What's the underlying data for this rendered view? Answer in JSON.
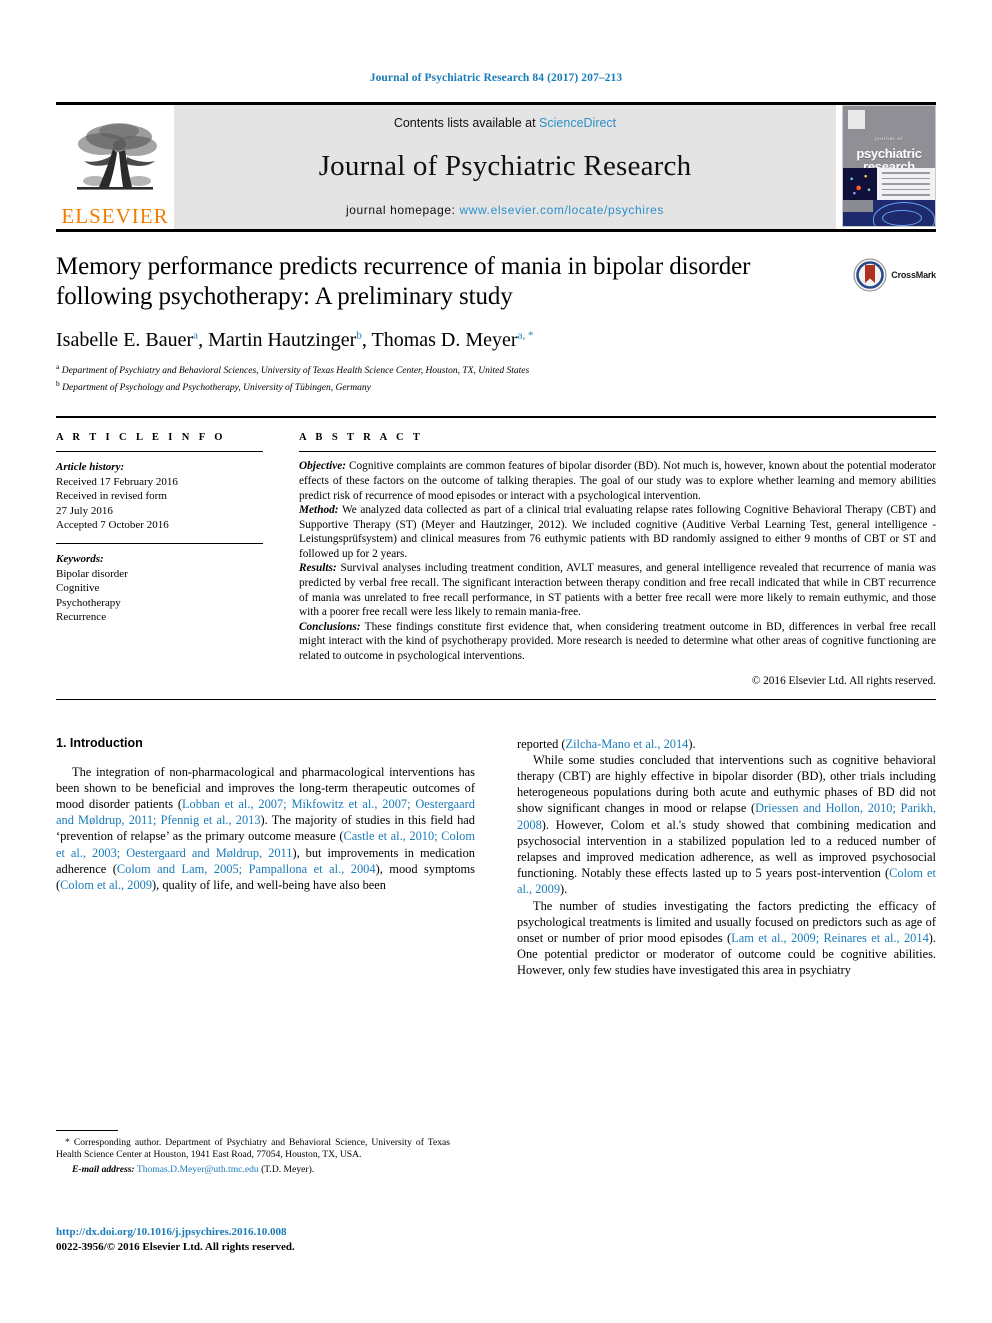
{
  "running_head": "Journal of Psychiatric Research 84 (2017) 207–213",
  "masthead": {
    "publisher_logo_label": "ELSEVIER",
    "contents_prefix": "Contents lists available at ",
    "contents_link": "ScienceDirect",
    "journal_name": "Journal of Psychiatric Research",
    "homepage_prefix": "journal homepage: ",
    "homepage_url": "www.elsevier.com/locate/psychires",
    "cover": {
      "overline": "journal of",
      "line1": "psychiatric",
      "line2": "research"
    },
    "accent_link_color": "#2b8fc9",
    "banner_bg": "#e4e4e4",
    "elsevier_orange": "#f07d00"
  },
  "article": {
    "title": "Memory performance predicts recurrence of mania in bipolar disorder following psychotherapy: A preliminary study",
    "authors": [
      {
        "name": "Isabelle E. Bauer",
        "marks": "a"
      },
      {
        "name": "Martin Hautzinger",
        "marks": "b"
      },
      {
        "name": "Thomas D. Meyer",
        "marks": "a, *"
      }
    ],
    "affiliations": [
      {
        "mark": "a",
        "text": "Department of Psychiatry and Behavioral Sciences, University of Texas Health Science Center, Houston, TX, United States"
      },
      {
        "mark": "b",
        "text": "Department of Psychology and Psychotherapy, University of Tübingen, Germany"
      }
    ],
    "crossmark_label": "CrossMark"
  },
  "info": {
    "heading": "A R T I C L E   I N F O",
    "history_label": "Article history:",
    "history": [
      "Received 17 February 2016",
      "Received in revised form",
      "27 July 2016",
      "Accepted 7 October 2016"
    ],
    "keywords_label": "Keywords:",
    "keywords": [
      "Bipolar disorder",
      "Cognitive",
      "Psychotherapy",
      "Recurrence"
    ]
  },
  "abstract": {
    "heading": "A B S T R A C T",
    "sections": [
      {
        "label": "Objective:",
        "text": " Cognitive complaints are common features of bipolar disorder (BD). Not much is, however, known about the potential moderator effects of these factors on the outcome of talking therapies. The goal of our study was to explore whether learning and memory abilities predict risk of recurrence of mood episodes or interact with a psychological intervention."
      },
      {
        "label": "Method:",
        "text": " We analyzed data collected as part of a clinical trial evaluating relapse rates following Cognitive Behavioral Therapy (CBT) and Supportive Therapy (ST) (Meyer and Hautzinger, 2012). We included cognitive (Auditive Verbal Learning Test, general intelligence - Leistungsprüfsystem) and clinical measures from 76 euthymic patients with BD randomly assigned to either 9 months of CBT or ST and followed up for 2 years."
      },
      {
        "label": "Results:",
        "text": " Survival analyses including treatment condition, AVLT measures, and general intelligence revealed that recurrence of mania was predicted by verbal free recall. The significant interaction between therapy condition and free recall indicated that while in CBT recurrence of mania was unrelated to free recall performance, in ST patients with a better free recall were more likely to remain euthymic, and those with a poorer free recall were less likely to remain mania-free."
      },
      {
        "label": "Conclusions:",
        "text": " These findings constitute first evidence that, when considering treatment outcome in BD, differences in verbal free recall might interact with the kind of psychotherapy provided. More research is needed to determine what other areas of cognitive functioning are related to outcome in psychological interventions."
      }
    ],
    "copyright": "© 2016 Elsevier Ltd. All rights reserved."
  },
  "introduction": {
    "heading": "1. Introduction",
    "left_paragraphs": [
      {
        "runs": [
          {
            "t": "The integration of non-pharmacological and pharmacological interventions has been shown to be beneficial and improves the long-term therapeutic outcomes of mood disorder patients ("
          },
          {
            "t": "Lobban et al., 2007; Mikfowitz et al., 2007; Oestergaard and Møldrup, 2011; Pfennig et al., 2013",
            "ref": true
          },
          {
            "t": "). The majority of studies in this field had ‘prevention of relapse’ as the primary outcome measure ("
          },
          {
            "t": "Castle et al., 2010; Colom et al., 2003; Oestergaard and Møldrup, 2011",
            "ref": true
          },
          {
            "t": "), but improvements in medication adherence ("
          },
          {
            "t": "Colom and Lam, 2005; Pampallona et al., 2004",
            "ref": true
          },
          {
            "t": "), mood symptoms ("
          },
          {
            "t": "Colom et al., 2009",
            "ref": true
          },
          {
            "t": "), quality of life, and well-being have also been "
          }
        ]
      }
    ],
    "right_paragraphs": [
      {
        "indent": false,
        "runs": [
          {
            "t": "reported ("
          },
          {
            "t": "Zilcha-Mano et al., 2014",
            "ref": true
          },
          {
            "t": ")."
          }
        ]
      },
      {
        "indent": true,
        "runs": [
          {
            "t": "While some studies concluded that interventions such as cognitive behavioral therapy (CBT) are highly effective in bipolar disorder (BD), other trials including heterogeneous populations during both acute and euthymic phases of BD did not show significant changes in mood or relapse ("
          },
          {
            "t": "Driessen and Hollon, 2010; Parikh, 2008",
            "ref": true
          },
          {
            "t": "). However, Colom et al.'s study showed that combining medication and psychosocial intervention in a stabilized population led to a reduced number of relapses and improved medication adherence, as well as improved psychosocial functioning. Notably these effects lasted up to 5 years post-intervention ("
          },
          {
            "t": "Colom et al., 2009",
            "ref": true
          },
          {
            "t": ")."
          }
        ]
      },
      {
        "indent": true,
        "runs": [
          {
            "t": "The number of studies investigating the factors predicting the efficacy of psychological treatments is limited and usually focused on predictors such as age of onset or number of prior mood episodes ("
          },
          {
            "t": "Lam et al., 2009; Reinares et al., 2014",
            "ref": true
          },
          {
            "t": "). One potential predictor or moderator of outcome could be cognitive abilities. However, only few studies have investigated this area in psychiatry"
          }
        ]
      }
    ]
  },
  "footnotes": {
    "corresponding_marker": "*",
    "corresponding": " Corresponding author. Department of Psychiatry and Behavioral Science, University of Texas Health Science Center at Houston, 1941 East Road, 77054, Houston, TX, USA.",
    "email_label": "E-mail address:",
    "email": "Thomas.D.Meyer@uth.tmc.edu",
    "email_suffix": " (T.D. Meyer)."
  },
  "doi": {
    "url": "http://dx.doi.org/10.1016/j.jpsychires.2016.10.008",
    "issn_line": "0022-3956/© 2016 Elsevier Ltd. All rights reserved."
  }
}
